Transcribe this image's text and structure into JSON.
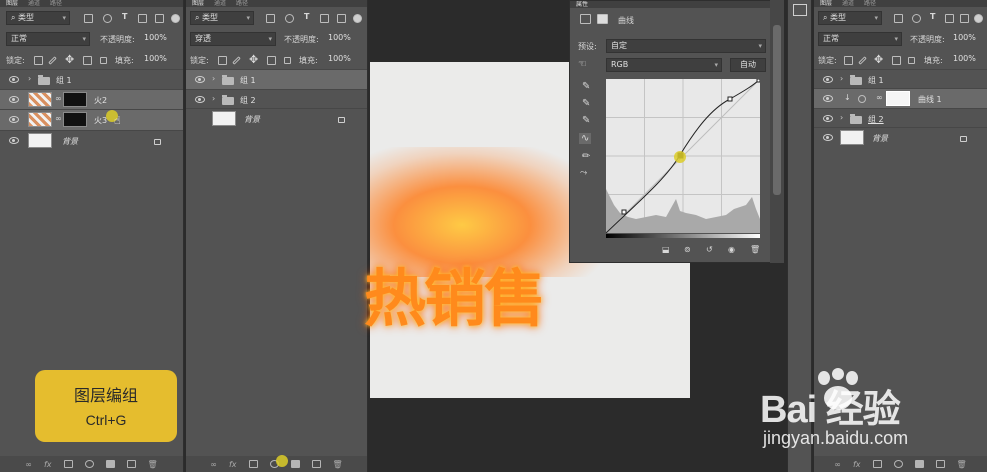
{
  "panel_tabs": [
    "图层",
    "通道",
    "路径"
  ],
  "filter_kind": "类型",
  "panel1": {
    "blend_mode": "正常",
    "opacity_label": "不透明度:",
    "opacity_value": "100%",
    "lock_label": "锁定:",
    "fill_label": "填充:",
    "fill_value": "100%",
    "layers": [
      {
        "name": "组 1",
        "kind": "group"
      },
      {
        "name": "火2",
        "kind": "image"
      },
      {
        "name": "火3",
        "kind": "image"
      },
      {
        "name": "背景",
        "kind": "background"
      }
    ]
  },
  "panel2": {
    "blend_mode": "穿透",
    "opacity_label": "不透明度:",
    "opacity_value": "100%",
    "lock_label": "锁定:",
    "fill_label": "填充:",
    "fill_value": "100%",
    "layers": [
      {
        "name": "组 1",
        "kind": "group"
      },
      {
        "name": "组 2",
        "kind": "group"
      },
      {
        "name": "背景",
        "kind": "background"
      }
    ]
  },
  "panel3": {
    "blend_mode": "正常",
    "opacity_label": "不透明度:",
    "opacity_value": "100%",
    "lock_label": "锁定:",
    "fill_label": "填充:",
    "fill_value": "100%",
    "layers": [
      {
        "name": "组 1",
        "kind": "group"
      },
      {
        "name": "曲线 1",
        "kind": "adjustment"
      },
      {
        "name": "组 2",
        "kind": "group"
      },
      {
        "name": "背景",
        "kind": "background"
      }
    ]
  },
  "properties": {
    "tab": "属性",
    "adjustment_name": "曲线",
    "preset_label": "预设:",
    "preset_value": "自定",
    "channel_value": "RGB",
    "auto_button": "自动"
  },
  "canvas_text": "热销售",
  "shortcut_overlay": {
    "title": "图层编组",
    "keys": "Ctrl+G"
  },
  "watermark": {
    "brand": "Bai  经验",
    "url": "jingyan.baidu.com"
  },
  "colors": {
    "panel_bg": "#535353",
    "selected_row": "#6a6a6a",
    "overlay": "#e5bd2e",
    "fire_orange": "#ff8a1c"
  }
}
